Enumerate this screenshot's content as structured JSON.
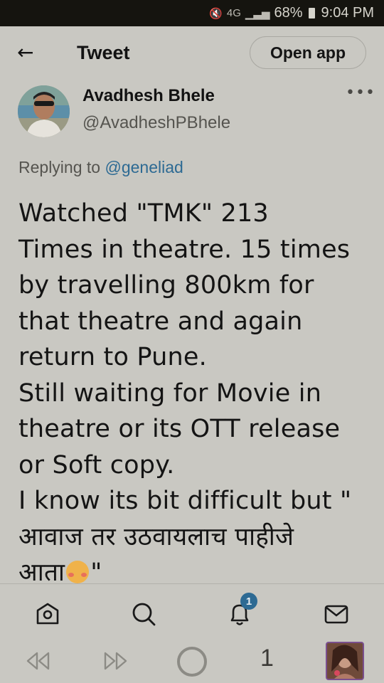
{
  "status_bar": {
    "network": "4G",
    "battery": "68%",
    "time": "9:04 PM"
  },
  "header": {
    "title": "Tweet",
    "open_app_label": "Open app",
    "back_icon": "arrow-left-icon"
  },
  "tweet": {
    "author_name": "Avadhesh Bhele",
    "author_handle": "@AvadheshPBhele",
    "replying_prefix": "Replying to",
    "replying_to": "@geneliad",
    "lines": [
      "Watched \"TMK\" 213",
      "Times in theatre. 15 times",
      "by travelling 800km for",
      "that theatre and again",
      "return to Pune.",
      "Still waiting for Movie in",
      "theatre or its OTT release",
      "or Soft copy.",
      "I know its bit difficult but \"",
      "आवाज तर उठवायलाच पाहीजे",
      "आता"
    ],
    "last_line_suffix": "\""
  },
  "tab_bar": {
    "items": [
      "home-icon",
      "search-icon",
      "notifications-icon",
      "messages-icon"
    ],
    "notifications_badge": "1"
  },
  "browser_nav": {
    "tab_count": "1"
  }
}
